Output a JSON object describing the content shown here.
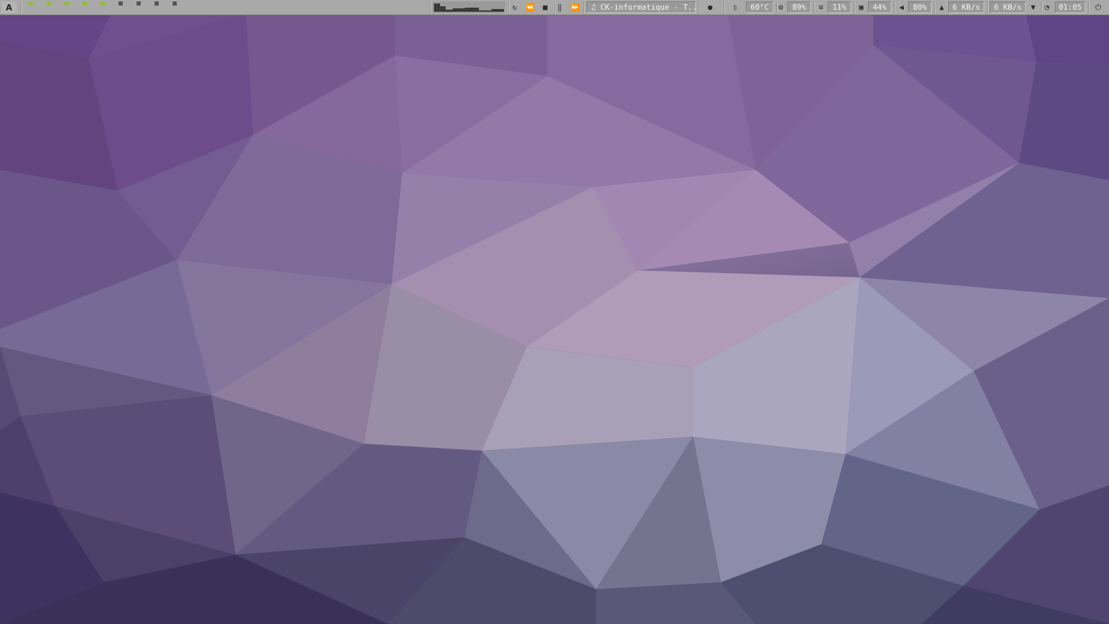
{
  "colors": {
    "panel_bg": "#a9a9a9",
    "field_bg": "#9a9a9a",
    "workspace_active": "#8fbf2e",
    "workspace_inactive": "#555555"
  },
  "launcher": {
    "label": "A",
    "icon": "arch-launcher-icon"
  },
  "workspaces": [
    {
      "state": "active"
    },
    {
      "state": "active"
    },
    {
      "state": "active"
    },
    {
      "state": "active"
    },
    {
      "state": "active"
    },
    {
      "state": "inactive"
    },
    {
      "state": "inactive"
    },
    {
      "state": "inactive"
    },
    {
      "state": "inactive"
    }
  ],
  "media": {
    "controls": [
      "repeat-icon",
      "previous-icon",
      "stop-icon",
      "pause-icon",
      "next-icon"
    ],
    "note_icon": "♫",
    "track": "CK-informatique - T..."
  },
  "status": {
    "drop_icon": "water-drop-icon",
    "temperature": "60°C",
    "cpu": "89%",
    "memory": "11%",
    "disk": "44%",
    "volume": "80%",
    "upload": "6 KB/s",
    "download": "6 KB/s",
    "time": "01:05"
  },
  "power_icon": "power-icon"
}
